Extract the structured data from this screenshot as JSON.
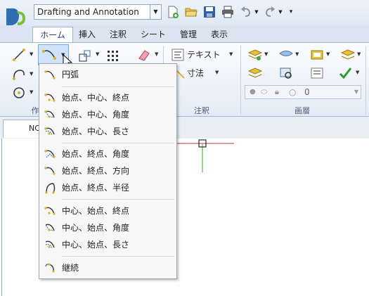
{
  "qat": {
    "workspace": "Drafting and Annotation"
  },
  "tabs": [
    {
      "label": "ホーム",
      "active": true
    },
    {
      "label": "挿入"
    },
    {
      "label": "注釈"
    },
    {
      "label": "シート"
    },
    {
      "label": "管理"
    },
    {
      "label": "表示"
    }
  ],
  "ribbon": {
    "text_label": "テキスト",
    "dimension_label": "寸法",
    "panel_draw": "作",
    "panel_annotate": "注釈",
    "panel_layer": "画層",
    "layer_value": "0"
  },
  "doc_tab": {
    "label": "NC"
  },
  "arc_menu": {
    "items": [
      {
        "label": "円弧",
        "icon": "arc-icon"
      },
      {
        "label": "始点、中心、終点",
        "icon": "arc-start-center-end-icon"
      },
      {
        "label": "始点、中心、角度",
        "icon": "arc-start-center-angle-icon"
      },
      {
        "label": "始点、中心、長さ",
        "icon": "arc-start-center-length-icon"
      },
      {
        "label": "始点、終点、角度",
        "icon": "arc-start-end-angle-icon"
      },
      {
        "label": "始点、終点、方向",
        "icon": "arc-start-end-direction-icon"
      },
      {
        "label": "始点、終点、半径",
        "icon": "arc-start-end-radius-icon"
      },
      {
        "label": "中心、始点、終点",
        "icon": "arc-center-start-end-icon"
      },
      {
        "label": "中心、始点、角度",
        "icon": "arc-center-start-angle-icon"
      },
      {
        "label": "中心、始点、長さ",
        "icon": "arc-center-start-length-icon"
      },
      {
        "label": "継続",
        "icon": "arc-continue-icon"
      }
    ]
  },
  "colors": {
    "accent": "#1b3f7a",
    "menu_bg": "#f7f7f7",
    "crosshair": "#c03030",
    "y_axis": "#30b030"
  }
}
